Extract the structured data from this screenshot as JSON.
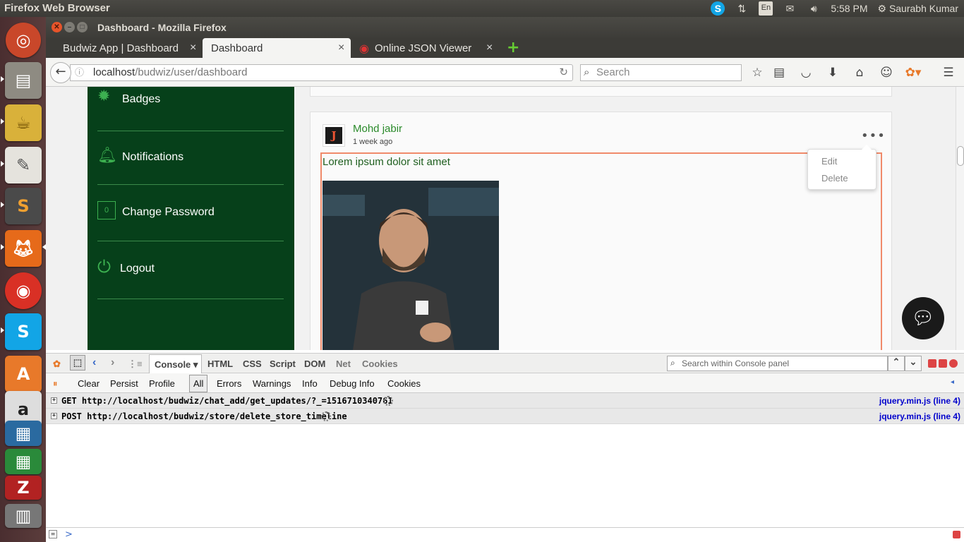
{
  "system": {
    "app_title": "Firefox Web Browser",
    "clock": "5:58 PM",
    "user": "Saurabh Kumar",
    "keyboard": "En"
  },
  "window": {
    "title": "Dashboard - Mozilla Firefox"
  },
  "tabs": [
    {
      "label": "Budwiz App | Dashboard"
    },
    {
      "label": "Dashboard"
    },
    {
      "label": "Online JSON Viewer"
    }
  ],
  "urlbar": {
    "host": "localhost",
    "path": "/budwiz/user/dashboard"
  },
  "search": {
    "placeholder": "Search"
  },
  "sidebar": {
    "items": [
      {
        "label": "Badges",
        "icon": "badge-icon"
      },
      {
        "label": "Notifications",
        "icon": "bell-icon"
      },
      {
        "label": "Change Password",
        "icon": "lock-icon"
      },
      {
        "label": "Logout",
        "icon": "power-icon"
      }
    ]
  },
  "post": {
    "author": "Mohd jabir",
    "avatar_letter": "J",
    "time": "1 week ago",
    "text": "Lorem ipsum dolor sit amet",
    "menu": [
      "Edit",
      "Delete"
    ]
  },
  "firebug": {
    "tabs": [
      "Console",
      "HTML",
      "CSS",
      "Script",
      "DOM",
      "Net",
      "Cookies"
    ],
    "search_placeholder": "Search within Console panel",
    "tools": [
      "Clear",
      "Persist",
      "Profile",
      "All",
      "Errors",
      "Warnings",
      "Info",
      "Debug Info",
      "Cookies"
    ],
    "logs": [
      {
        "text": "GET http://localhost/budwiz/chat_add/get_updates/?_=1516710340761",
        "source": "jquery.min.js (line 4)"
      },
      {
        "text": "POST http://localhost/budwiz/store/delete_store_timeline",
        "source": "jquery.min.js (line 4)"
      }
    ],
    "prompt": ">"
  },
  "colors": {
    "sidebar_bg": "#06401a",
    "accent_green": "#2a8a2a",
    "post_border": "#f08a6a"
  }
}
